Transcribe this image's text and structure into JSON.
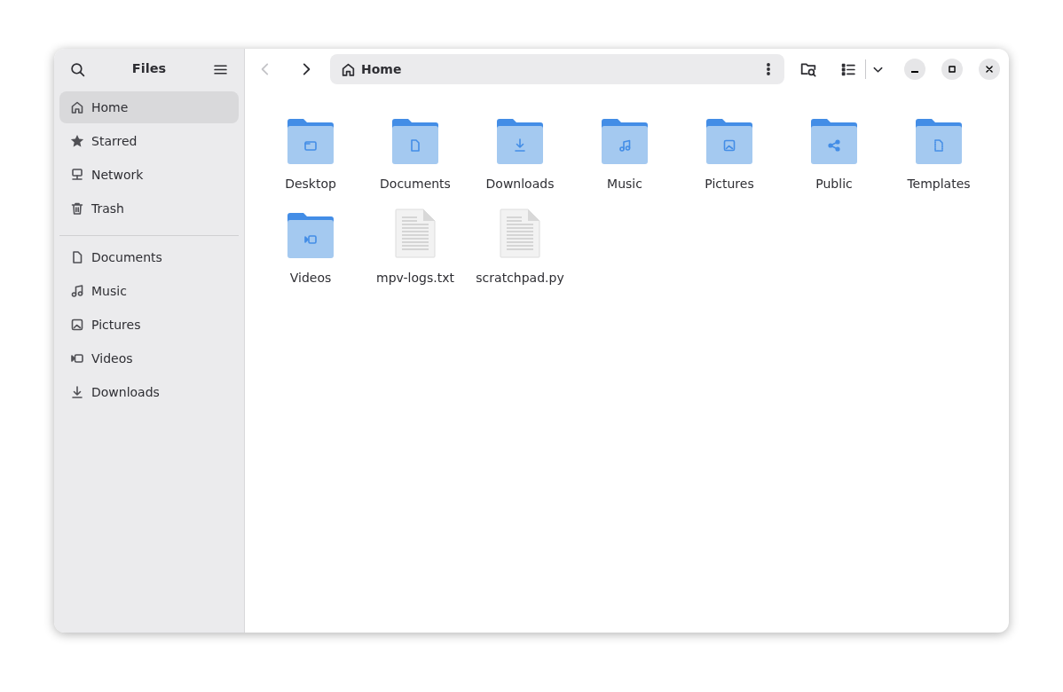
{
  "sidebar": {
    "title": "Files",
    "places": [
      {
        "label": "Home",
        "selected": true
      },
      {
        "label": "Starred",
        "selected": false
      },
      {
        "label": "Network",
        "selected": false
      },
      {
        "label": "Trash",
        "selected": false
      }
    ],
    "bookmarks": [
      {
        "label": "Documents",
        "selected": false
      },
      {
        "label": "Music",
        "selected": false
      },
      {
        "label": "Pictures",
        "selected": false
      },
      {
        "label": "Videos",
        "selected": false
      },
      {
        "label": "Downloads",
        "selected": false
      }
    ]
  },
  "toolbar": {
    "back_disabled": true,
    "forward_disabled": false,
    "location": "Home"
  },
  "items": [
    {
      "name": "Desktop",
      "kind": "folder"
    },
    {
      "name": "Documents",
      "kind": "folder"
    },
    {
      "name": "Downloads",
      "kind": "folder"
    },
    {
      "name": "Music",
      "kind": "folder"
    },
    {
      "name": "Pictures",
      "kind": "folder"
    },
    {
      "name": "Public",
      "kind": "folder"
    },
    {
      "name": "Templates",
      "kind": "folder"
    },
    {
      "name": "Videos",
      "kind": "folder"
    },
    {
      "name": "mpv-logs.txt",
      "kind": "file"
    },
    {
      "name": "scratchpad.py",
      "kind": "file"
    }
  ]
}
